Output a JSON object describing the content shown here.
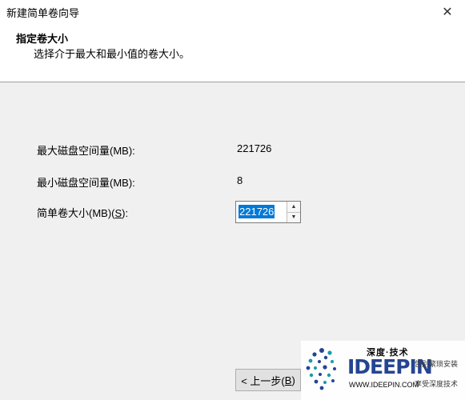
{
  "window": {
    "title": "新建简单卷向导",
    "close_glyph": "✕"
  },
  "header": {
    "title": "指定卷大小",
    "subtitle": "选择介于最大和最小值的卷大小。"
  },
  "form": {
    "max_label": "最大磁盘空间量(MB):",
    "max_value": "221726",
    "min_label": "最小磁盘空间量(MB):",
    "min_value": "8",
    "size_label_prefix": "简单卷大小(MB)(",
    "size_label_key": "S",
    "size_label_suffix": "):",
    "size_value": "221726",
    "spin_up_glyph": "▲",
    "spin_down_glyph": "▼"
  },
  "footer": {
    "back_prefix": "< 上一步(",
    "back_key": "B",
    "back_suffix": ")"
  },
  "watermark": {
    "top_text": "深度·技术",
    "brand": "IDEEPIN",
    "url": "WWW.IDEEPIN.COM",
    "right_line1": "告别繁琐安装",
    "right_line2": "享受深度技术"
  },
  "colors": {
    "selection": "#0078d7",
    "brand_blue": "#1f3f8f",
    "brand_teal": "#0f9aa6"
  }
}
